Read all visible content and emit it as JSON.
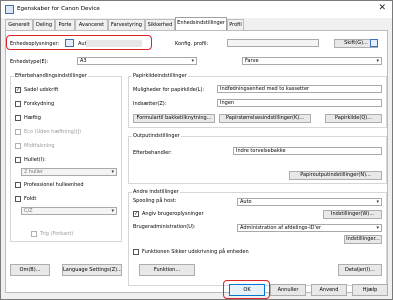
{
  "window": {
    "title": "Egenskaber for Canon Device",
    "close_glyph": "✕"
  },
  "tabs": [
    "Generelt",
    "Deling",
    "Porte",
    "Avanceret",
    "Farvestyring",
    "Sikkerhed",
    "Enhedsindstillinger",
    "Profil"
  ],
  "active_tab": "Enhedsindstillinger",
  "top": {
    "enhedsoplysninger_label": "Enhedsoplysninger:",
    "enhedsoplysninger_value": "Auto (",
    "konfig_profil_label": "Konfig. profil:",
    "skift_button": "Skift(G)..."
  },
  "enhedstype": {
    "label": "Enhedstype(E):",
    "paper_value": "A3",
    "color_value": "Farve"
  },
  "efterbehandling": {
    "title": "Efterbehandlingsindstillinger",
    "sadel": "Sadel udskrift",
    "forskydning": "Forskydning",
    "haefte": "Hæftig",
    "eco": "Eco (Uden hæftning)(J)",
    "midtfoldning": "Midtfalsning",
    "hullet": "Hullet(I):",
    "hul_select": "2 huller",
    "professionel": "Professionel hulleenhed",
    "foldt": "Foldt",
    "foldt_select": "C/Z",
    "trig": "Trig (Forkant)"
  },
  "papirkilde": {
    "title": "Papirkildeindstillinger",
    "muligheder_label": "Muligheder for papirkilde(L):",
    "muligheder_value": "Indfødningsenhed med to kassetter",
    "indsaetter_label": "Indsætter(Z):",
    "indsaetter_value": "Ingen",
    "btn_formular": "Formulartil bakketilknytning...",
    "btn_papirstorrelse": "Papirstørrelsesindstillinger(K)...",
    "btn_papirkilde": "Papirkilde(Q)..."
  },
  "outputkilde": {
    "title": "Outputindstillinger",
    "efterbehandler_label": "Efterbehandler:",
    "efterbehandler_value": "Indre torvelsebakke",
    "btn_papiroutput": "Papiroutputindstillinger(N)..."
  },
  "andre": {
    "title": "Andre indstillinger",
    "spooling_label": "Spooling på host:",
    "spooling_value": "Auto",
    "angiv_label": "Angiv brugeroplysninger",
    "btn_indstillinger1": "Indstillinger(W)...",
    "brugeradm_label": "Brugeradministration(U):",
    "brugeradm_value": "Administration af afdelings-ID'er",
    "btn_indstillinger2": "Indstillinger...",
    "funktioner_label": "Funktionen Sikker udskrivning på enheden"
  },
  "bottom_buttons": {
    "om": "Om(B)...",
    "language": "Language Settings(Z)...",
    "funktion": "Funktion...",
    "detaljer": "Detaljer(I)..."
  },
  "footer": {
    "ok": "OK",
    "annuller": "Annuller",
    "anvend": "Anvend",
    "hjaelp": "Hjælp"
  }
}
